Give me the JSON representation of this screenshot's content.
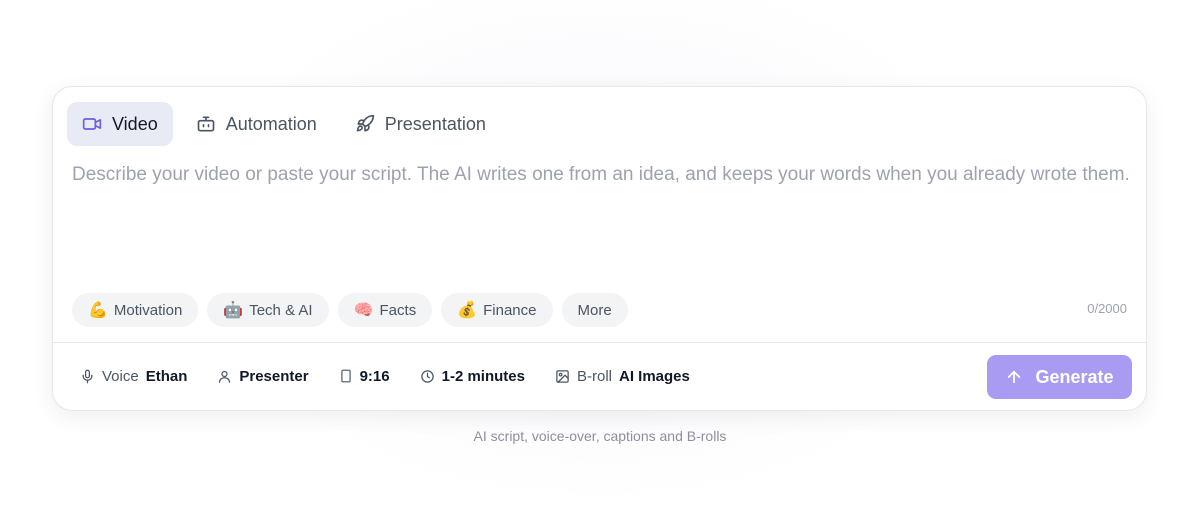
{
  "tabs": [
    {
      "label": "Video",
      "icon": "video-camera-icon",
      "active": true
    },
    {
      "label": "Automation",
      "icon": "robot-icon",
      "active": false
    },
    {
      "label": "Presentation",
      "icon": "rocket-icon",
      "active": false
    }
  ],
  "prompt": {
    "placeholder": "Describe your video or paste your script. The AI writes one from an idea, and keeps your words when you already wrote them.",
    "value": ""
  },
  "chips": [
    {
      "emoji": "💪",
      "label": "Motivation"
    },
    {
      "emoji": "🤖",
      "label": "Tech & AI"
    },
    {
      "emoji": "🧠",
      "label": "Facts"
    },
    {
      "emoji": "💰",
      "label": "Finance"
    },
    {
      "emoji": "",
      "label": "More"
    }
  ],
  "char_count": "0/2000",
  "options": {
    "voice": {
      "label": "Voice",
      "value": "Ethan",
      "icon": "microphone-icon"
    },
    "presenter": {
      "label": "Presenter",
      "icon": "user-icon"
    },
    "aspect": {
      "label": "9:16",
      "icon": "phone-portrait-icon"
    },
    "duration": {
      "label": "1-2 minutes",
      "icon": "clock-icon"
    },
    "broll": {
      "label": "B-roll",
      "value": "AI Images",
      "icon": "image-icon"
    }
  },
  "generate": {
    "label": "Generate",
    "icon": "arrow-up-icon",
    "color": "#a99af2"
  },
  "caption": "AI script, voice-over, captions and B-rolls",
  "colors": {
    "accent": "#6d5ce8",
    "active_tab_bg": "#e8ebf3"
  }
}
